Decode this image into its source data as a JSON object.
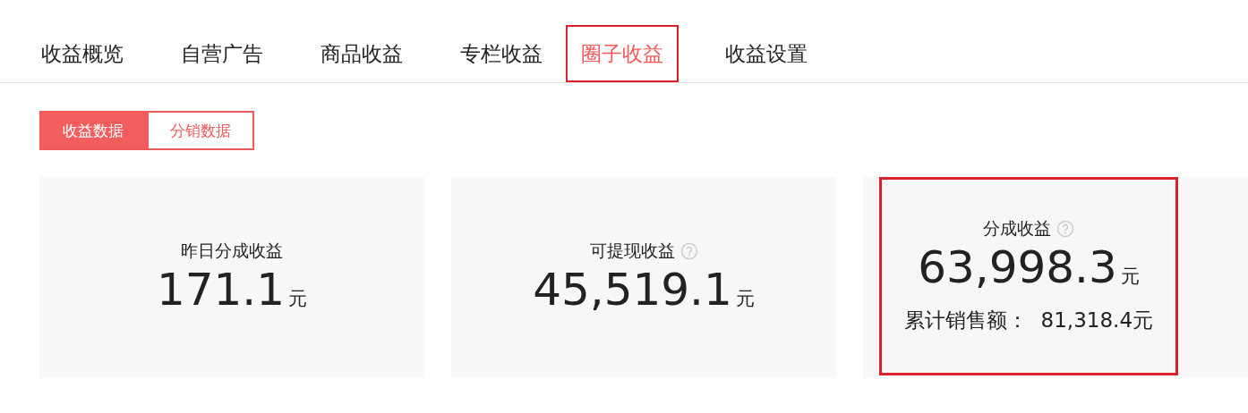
{
  "tabs": [
    {
      "label": "收益概览",
      "selected": false,
      "highlighted": false
    },
    {
      "label": "自营广告",
      "selected": false,
      "highlighted": false
    },
    {
      "label": "商品收益",
      "selected": false,
      "highlighted": false
    },
    {
      "label": "专栏收益",
      "selected": false,
      "highlighted": false
    },
    {
      "label": "圈子收益",
      "selected": true,
      "highlighted": true
    },
    {
      "label": "收益设置",
      "selected": false,
      "highlighted": false
    }
  ],
  "segments": [
    {
      "label": "收益数据",
      "selected": true
    },
    {
      "label": "分销数据",
      "selected": false
    }
  ],
  "cards": [
    {
      "title": "昨日分成收益",
      "help": false,
      "value": "171.1",
      "unit": "元",
      "highlighted": false
    },
    {
      "title": "可提现收益",
      "help": true,
      "value": "45,519.1",
      "unit": "元",
      "highlighted": false
    },
    {
      "title": "分成收益",
      "help": true,
      "value": "63,998.3",
      "unit": "元",
      "extra": "累计销售额：  81,318.4元",
      "highlighted": true
    }
  ]
}
